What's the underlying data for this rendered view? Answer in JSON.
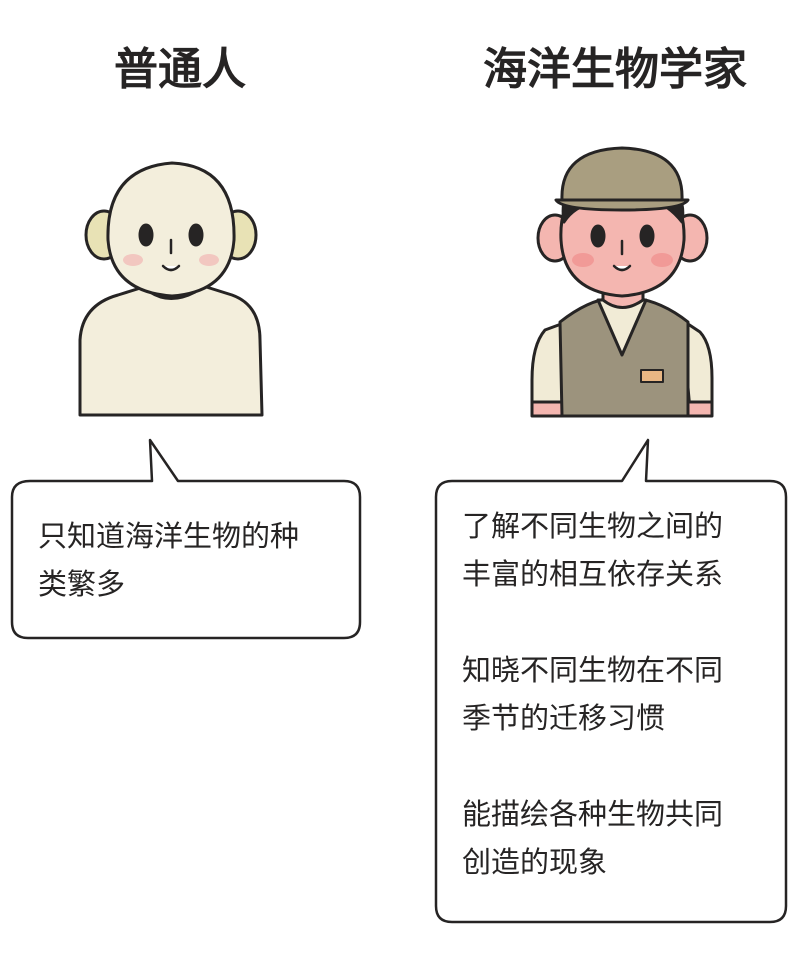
{
  "left": {
    "title": "普通人",
    "bubble_lines": [
      "只知道海洋生物的种",
      "类繁多"
    ]
  },
  "right": {
    "title": "海洋生物学家",
    "bubble_groups": [
      [
        "了解不同生物之间的",
        "丰富的相互依存关系"
      ],
      [
        "知晓不同生物在不同",
        "季节的迁移习惯"
      ],
      [
        "能描绘各种生物共同",
        "创造的现象"
      ]
    ]
  },
  "colors": {
    "skin_plain": "#f3eedc",
    "skin_pink": "#f4b6b0",
    "cap": "#a99e80",
    "vest": "#9c937d",
    "shirt": "#f1ebd6",
    "outline": "#262424",
    "cheek": "#f19a97",
    "neck_shadow": "#e8e2b5"
  }
}
